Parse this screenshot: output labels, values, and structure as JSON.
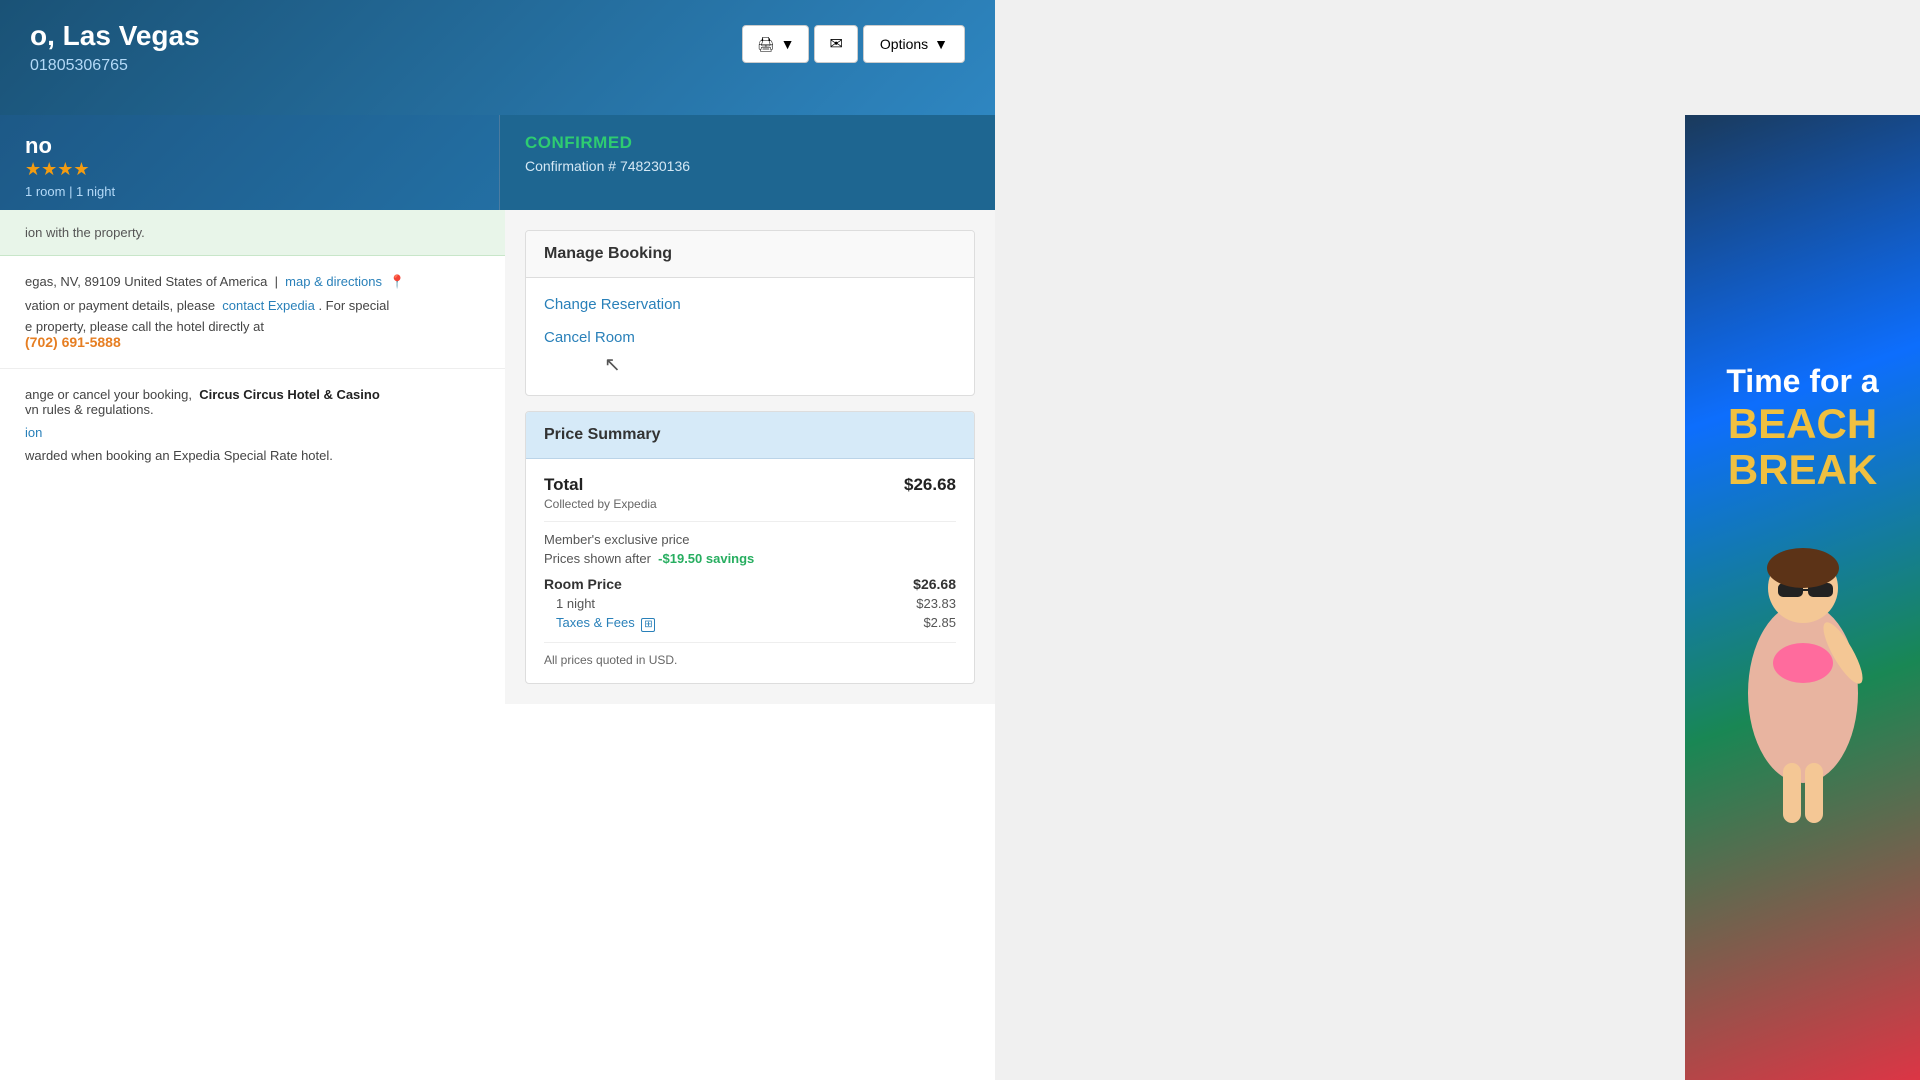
{
  "header": {
    "hotel_name": "o, Las Vegas",
    "booking_id": "01805306765",
    "print_label": "🖨",
    "print_dropdown": "▼",
    "email_label": "✉",
    "options_label": "Options",
    "options_dropdown": "▼"
  },
  "hotel_info": {
    "short_name": "no",
    "stars": "★★★★",
    "room_count": "1 room | 1 night"
  },
  "confirmation": {
    "status": "CONFIRMED",
    "label": "Confirmation #",
    "number": "748230136"
  },
  "property_notice": {
    "text": "ion with the property."
  },
  "address": {
    "address_line": "egas, NV, 89109 United States of America",
    "map_link": "map & directions",
    "contact_prefix": "vation or payment details, please",
    "contact_link": "contact Expedia",
    "contact_suffix": ". For special",
    "property_prefix": "e property, please call the hotel directly at",
    "phone": "(702) 691-5888"
  },
  "cancel_info": {
    "prefix": "ange or cancel your booking,",
    "hotel_name_bold": "Circus Circus Hotel & Casino",
    "suffix": "vn rules & regulations.",
    "link_text": "ion",
    "awards_text": "warded when booking an Expedia Special Rate hotel."
  },
  "manage_booking": {
    "title": "Manage Booking",
    "change_reservation": "Change Reservation",
    "cancel_room": "Cancel Room"
  },
  "price_summary": {
    "title": "Price Summary",
    "total_label": "Total",
    "total_amount": "$26.68",
    "collected_by": "Collected by Expedia",
    "member_exclusive": "Member's exclusive price",
    "savings_prefix": "Prices shown after",
    "savings_amount": "-$19.50 savings",
    "room_price_label": "Room Price",
    "room_price_amount": "$26.68",
    "night_label": "1 night",
    "night_amount": "$23.83",
    "taxes_label": "Taxes & Fees",
    "taxes_amount": "$2.85",
    "usd_note": "All prices quoted in USD."
  },
  "ad": {
    "line1": "Time for a",
    "line2": "BEACH",
    "line3": "BREAK"
  }
}
